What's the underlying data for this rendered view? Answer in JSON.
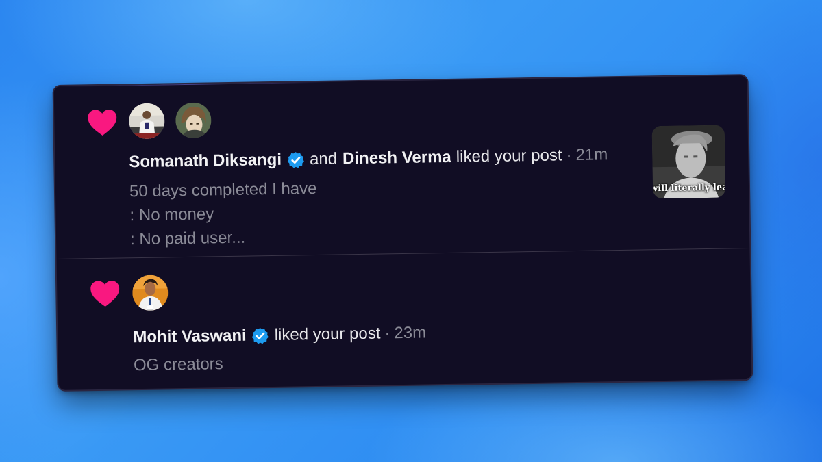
{
  "notifications": [
    {
      "type": "like",
      "icon": "heart-icon",
      "icon_color": "#f91880",
      "users": [
        {
          "name": "Somanath Diksangi",
          "verified": true
        },
        {
          "name": "Dinesh Verma",
          "verified": false
        }
      ],
      "connector": "and",
      "action": "liked your post",
      "separator": "·",
      "time": "21m",
      "preview_lines": [
        "50 days completed I have",
        ": No money",
        ": No paid user..."
      ],
      "thumbnail_caption": "will literally leav"
    },
    {
      "type": "like",
      "icon": "heart-icon",
      "icon_color": "#f91880",
      "users": [
        {
          "name": "Mohit Vaswani",
          "verified": true
        }
      ],
      "action": "liked your post",
      "separator": "·",
      "time": "23m",
      "preview_lines": [
        "OG creators"
      ]
    }
  ],
  "colors": {
    "heart": "#f91880",
    "verified_badge": "#1d9bf0",
    "card_background": "#110d24",
    "primary_text": "#e7e7ea",
    "muted_text": "#8b8b97"
  }
}
